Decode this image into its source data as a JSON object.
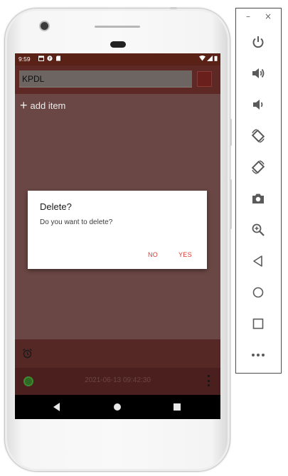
{
  "status_bar": {
    "time": "9:59"
  },
  "header": {
    "name_value": "KPDL"
  },
  "content": {
    "add_item_label": "add item"
  },
  "dialog": {
    "title": "Delete?",
    "message": "Do you want to delete?",
    "no_label": "NO",
    "yes_label": "YES"
  },
  "footer": {
    "timestamp": "2021-06-13 09:42:30"
  },
  "emulator_toolbar": {
    "minimize": "–",
    "close": "×",
    "buttons": [
      "power-icon",
      "volume-up-icon",
      "volume-down-icon",
      "rotate-left-icon",
      "rotate-right-icon",
      "camera-icon",
      "zoom-in-icon",
      "back-icon",
      "home-icon",
      "overview-icon",
      "more-icon"
    ]
  },
  "colors": {
    "accent": "#d63a2f",
    "header_bg": "#5e2925",
    "status_bar_bg": "#5a2116",
    "toolbar_icon": "#5a5a5a"
  }
}
